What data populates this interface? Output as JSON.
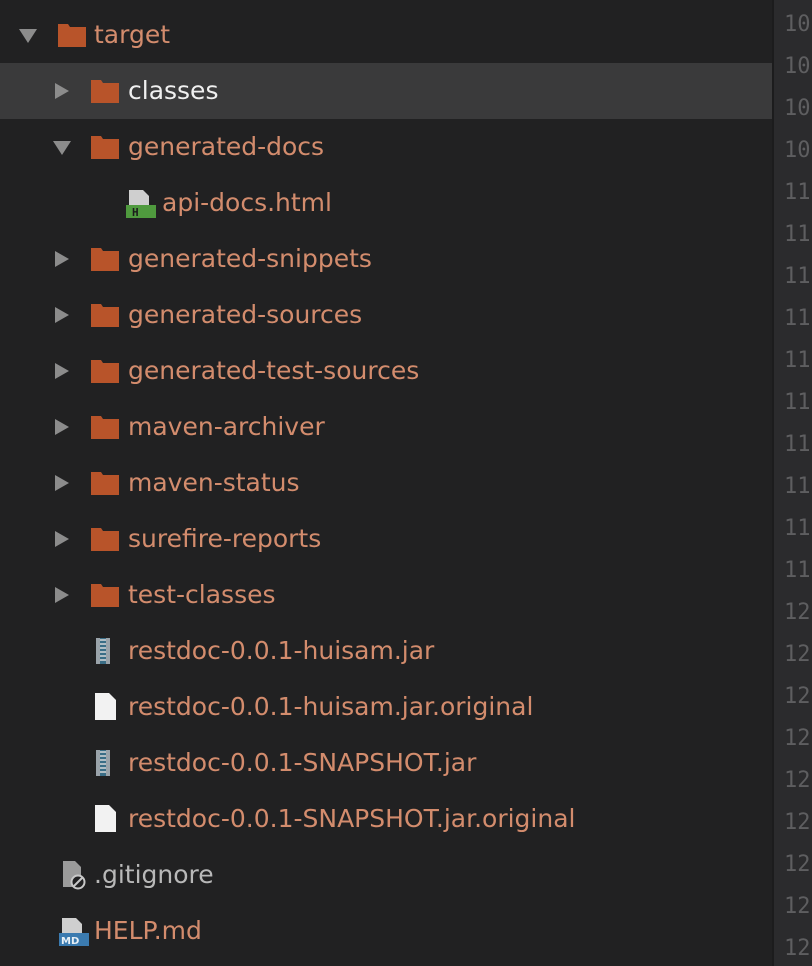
{
  "tree": {
    "items": [
      {
        "label": "target",
        "type": "folder",
        "expanded": true
      },
      {
        "label": "classes",
        "type": "folder",
        "expanded": false,
        "selected": true
      },
      {
        "label": "generated-docs",
        "type": "folder",
        "expanded": true
      },
      {
        "label": "api-docs.html",
        "type": "html-file"
      },
      {
        "label": "generated-snippets",
        "type": "folder",
        "expanded": false
      },
      {
        "label": "generated-sources",
        "type": "folder",
        "expanded": false
      },
      {
        "label": "generated-test-sources",
        "type": "folder",
        "expanded": false
      },
      {
        "label": "maven-archiver",
        "type": "folder",
        "expanded": false
      },
      {
        "label": "maven-status",
        "type": "folder",
        "expanded": false
      },
      {
        "label": "surefire-reports",
        "type": "folder",
        "expanded": false
      },
      {
        "label": "test-classes",
        "type": "folder",
        "expanded": false
      },
      {
        "label": "restdoc-0.0.1-huisam.jar",
        "type": "jar-file"
      },
      {
        "label": "restdoc-0.0.1-huisam.jar.original",
        "type": "text-file"
      },
      {
        "label": "restdoc-0.0.1-SNAPSHOT.jar",
        "type": "jar-file"
      },
      {
        "label": "restdoc-0.0.1-SNAPSHOT.jar.original",
        "type": "text-file"
      },
      {
        "label": ".gitignore",
        "type": "ignored-file"
      },
      {
        "label": "HELP.md",
        "type": "markdown-file"
      }
    ]
  },
  "gutter": {
    "line_numbers": [
      "10",
      "10",
      "10",
      "10",
      "11",
      "11",
      "11",
      "11",
      "11",
      "11",
      "11",
      "11",
      "11",
      "11",
      "12",
      "12",
      "12",
      "12",
      "12",
      "12",
      "12",
      "12",
      "12"
    ]
  },
  "colors": {
    "tree_background": "#212122",
    "selected_row": "#3a3a3b",
    "folder_orange": "#b8542a",
    "label_text": "#d38c6d",
    "selected_text": "#f0f0f0",
    "gutter_background": "#2b2b2d"
  },
  "icons": {
    "folder": "folder-icon",
    "html_file": "html-file-icon",
    "jar_file": "jar-file-icon",
    "text_file": "text-file-icon",
    "ignored_file": "gitignore-file-icon",
    "markdown_file": "markdown-file-icon"
  }
}
